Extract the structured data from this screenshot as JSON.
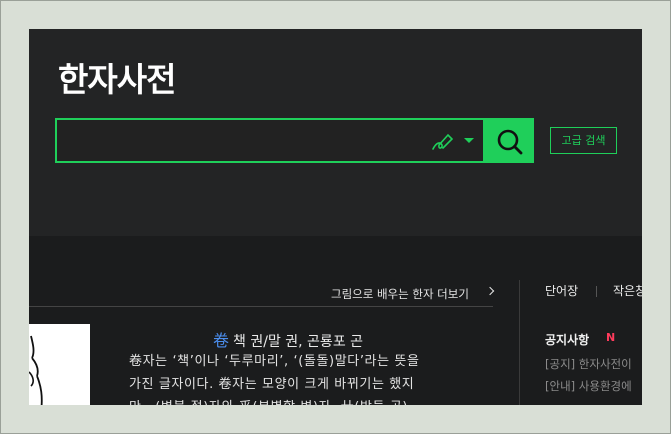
{
  "header": {
    "title": "한자사전",
    "search": {
      "value": "",
      "placeholder": ""
    },
    "advanced_search_label": "고급 검색"
  },
  "content": {
    "picture_learn_more": "그림으로 배우는 한자 더보기",
    "hanja": {
      "char": "卷",
      "meanings": "책 권/말 권, 곤룡포 곤",
      "description_lines": [
        "卷자는 ‘책’이나 ‘두루마리’, ‘(돌돌)말다’라는 뜻을",
        "가진 글자이다. 卷자는 모양이 크게 바뀌기는 했지",
        "만 ␣(변불 절)자와 釆(분별할 변)자, 廾(받들 공)"
      ]
    }
  },
  "sidebar": {
    "tab_wordbook": "단어장",
    "tab_second": "작은창",
    "notice_title": "공지사항",
    "notice_new_badge": "N",
    "notices": [
      "[공지] 한자사전이",
      "[안내] 사용환경에"
    ]
  },
  "colors": {
    "accent": "#1fcf5a",
    "background": "#232425",
    "link_blue": "#4b8eee"
  }
}
